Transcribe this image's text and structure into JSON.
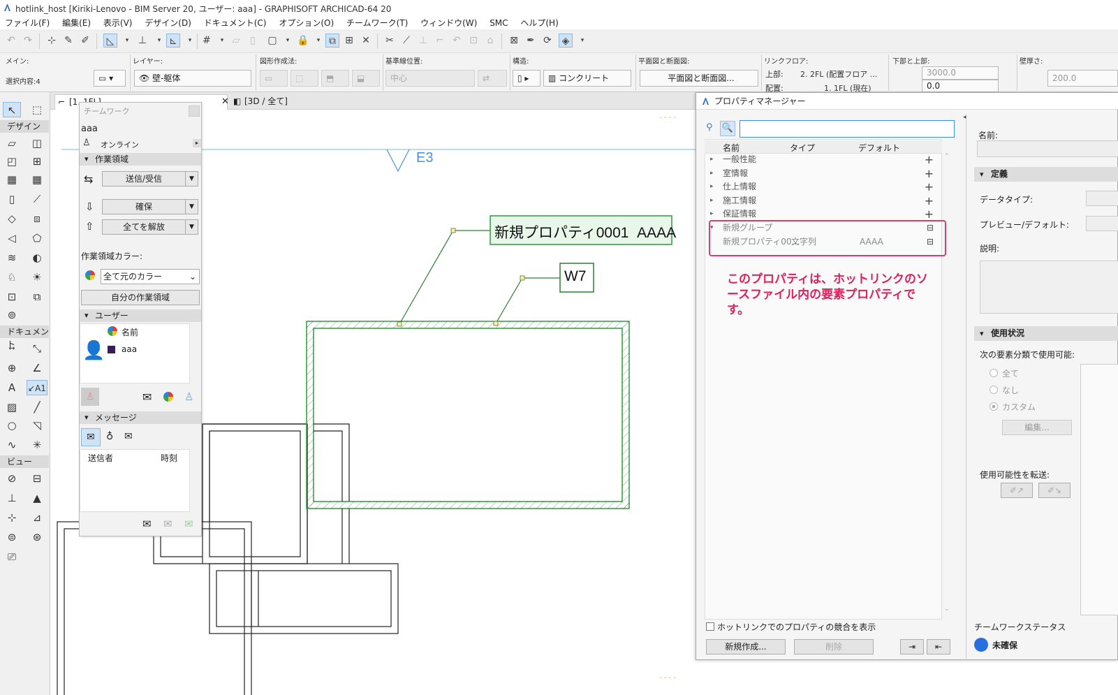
{
  "window": {
    "title": "hotlink_host [Kiriki-Lenovo - BIM Server 20, ユーザー: aaa] - GRAPHISOFT ARCHICAD-64 20"
  },
  "menu": [
    "ファイル(F)",
    "編集(E)",
    "表示(V)",
    "デザイン(D)",
    "ドキュメント(C)",
    "オプション(O)",
    "チームワーク(T)",
    "ウィンドウ(W)",
    "SMC",
    "ヘルプ(H)"
  ],
  "infobox": {
    "main_label": "メイン:",
    "selection": "選択内容:4",
    "layer_label": "レイヤー:",
    "layer_value": "壁-躯体",
    "geometry_label": "図形作成法:",
    "refline_label": "基準線位置:",
    "refline_value": "中心",
    "structure_label": "構造:",
    "structure_value": "コンクリート",
    "floorplan_label": "平面図と断面図:",
    "floorplan_value": "平面図と断面図...",
    "linkfloor_label": "リンクフロア:",
    "top_label": "上部:",
    "top_value": "2. 2FL (配置フロア ...",
    "place_label": "配置:",
    "place_value": "1. 1FL (現在)",
    "bottomtop_label": "下部と上部:",
    "height1": "3000.0",
    "height2": "0.0",
    "thickness_label": "壁厚さ:",
    "thickness": "200.0"
  },
  "toolbox": {
    "design": "デザイン",
    "document": "ドキュメント",
    "view": "ビュー"
  },
  "tabs": [
    {
      "label": "[1. 1FL]"
    },
    {
      "label": "[3D / 全て]"
    }
  ],
  "canvas": {
    "elevation_marker": "E3",
    "label1": "新規プロパティ0001  AAAA",
    "label2": "W7"
  },
  "teamwork": {
    "title": "チームワーク",
    "user": "aaa",
    "status": "オンライン",
    "workspace_section": "作業領域",
    "send_receive": "送信/受信",
    "reserve": "確保",
    "release_all": "全てを解放",
    "workspace_color_label": "作業領域カラー:",
    "color_option": "全て元のカラー",
    "my_workspace": "自分の作業領域",
    "users_section": "ユーザー",
    "users_header": "名前",
    "user_row": "aaa",
    "messages_section": "メッセージ",
    "col_sender": "送信者",
    "col_time": "時刻"
  },
  "propmgr": {
    "title": "プロパティマネージャー",
    "search_value": "",
    "col_name": "名前",
    "col_type": "タイプ",
    "col_default": "デフォルト",
    "groups": [
      "一般性能",
      "室情報",
      "仕上情報",
      "施工情報",
      "保証情報"
    ],
    "new_group": "新規グループ",
    "prop_name": "新規プロパティ00...",
    "prop_type": "文字列",
    "prop_default": "AAAA",
    "annotation": "このプロパティは、ホットリンクのソースファイル内の要素プロパティです。",
    "annotation_color": "#e0205a",
    "checkbox_label": "ホットリンクでのプロパティの競合を表示",
    "btn_new": "新規作成...",
    "btn_delete": "削除",
    "right": {
      "name_label": "名前:",
      "definition": "定義",
      "datatype_label": "データタイプ:",
      "preview_label": "プレビュー/デフォルト:",
      "desc_label": "説明:",
      "usage": "使用状況",
      "avail_label": "次の要素分類で使用可能:",
      "opt_all": "全て",
      "opt_none": "なし",
      "opt_custom": "カスタム",
      "edit_btn": "編集...",
      "transfer_label": "使用可能性を転送:",
      "tw_status_label": "チームワークステータス",
      "tw_status": "未確保"
    }
  },
  "colors": {
    "accent_blue": "#4a90d9",
    "element_green": "#2e9a3e",
    "highlight_red": "#e23a6a"
  }
}
